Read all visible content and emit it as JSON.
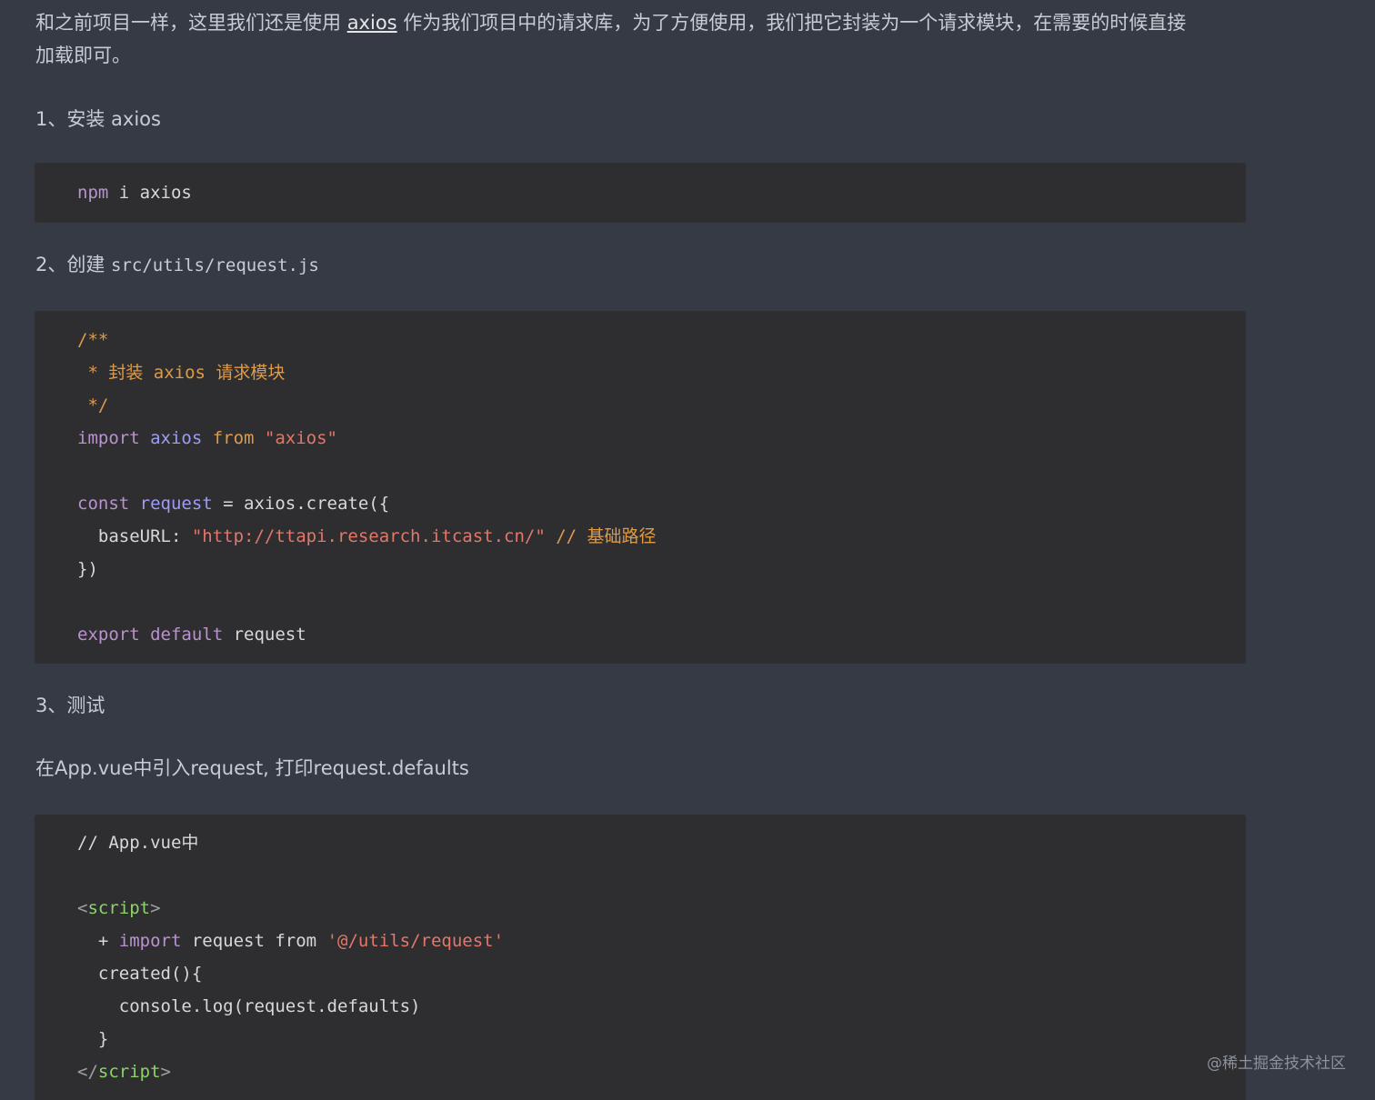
{
  "intro": {
    "before_link": "和之前项目一样，这里我们还是使用 ",
    "link_text": "axios",
    "after_link": " 作为我们项目中的请求库，为了方便使用，我们把它封装为一个请求模块，在需要的时候直接",
    "line2": "加载即可。"
  },
  "step1": {
    "text": "1、安装 axios"
  },
  "code1": {
    "cmd": "npm",
    "rest": " i axios"
  },
  "step2": {
    "prefix": "2、创建 ",
    "path": "src/utils/request.js"
  },
  "code2": {
    "c1": "/**",
    "c2": " * 封装 axios 请求模块",
    "c3": " */",
    "l4_import": "import",
    "l4_axios": " axios",
    "l4_from": " from",
    "l4_str": " \"axios\"",
    "l6_const": "const",
    "l6_var": " request",
    "l6_rest": " = axios.create({",
    "l7_key": "  baseURL: ",
    "l7_str": "\"http://ttapi.research.itcast.cn/\"",
    "l7_cmt": " // 基础路径",
    "l8": "})",
    "l10_export": "export",
    "l10_default": " default",
    "l10_rest": " request"
  },
  "step3": {
    "text": "3、测试"
  },
  "desc": {
    "text": "在App.vue中引入request, 打印request.defaults"
  },
  "code3": {
    "c1": "// App.vue中",
    "tag_open_lt": "<",
    "tag_open_name": "script",
    "tag_open_gt": ">",
    "l4_plus": "  + ",
    "l4_import": "import",
    "l4_rest": " request from ",
    "l4_str": "'@/utils/request'",
    "l5": "  created(){",
    "l6": "    console.log(request.defaults)",
    "l7": "  }",
    "tag_close_lt": "</",
    "tag_close_name": "script",
    "tag_close_gt": ">"
  },
  "watermark": {
    "text": "@稀土掘金技术社区"
  }
}
